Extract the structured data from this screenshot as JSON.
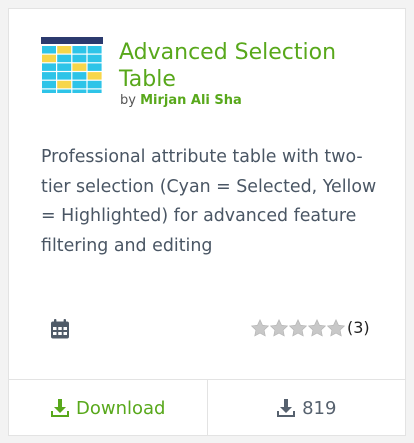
{
  "plugin": {
    "title": "Advanced Selection Table",
    "author_prefix": "by",
    "author": "Mirjan Ali Sha",
    "description": "Professional attribute table with two-tier selection (Cyan = Selected, Yellow = Highlighted) for advanced feature filtering and editing",
    "icon": "table-grid-icon"
  },
  "meta": {
    "calendar_icon": "calendar-icon",
    "rating_count": "(3)",
    "rating_stars": 5,
    "rating_value": 0
  },
  "footer": {
    "download_label": "Download",
    "download_icon": "download-icon",
    "downloads_count": "819"
  },
  "colors": {
    "accent": "#58a81b",
    "text": "#4a5664",
    "star": "#c8c8c8"
  }
}
